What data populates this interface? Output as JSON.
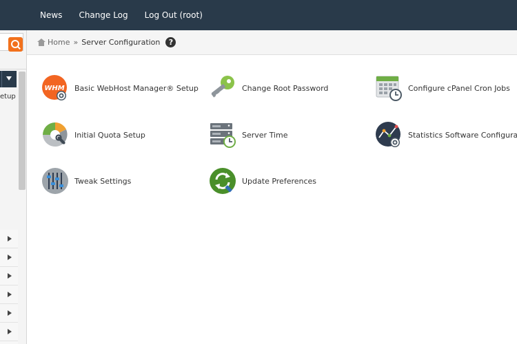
{
  "topnav": {
    "items": [
      {
        "label": "News"
      },
      {
        "label": "Change Log"
      },
      {
        "label": "Log Out (root)"
      }
    ]
  },
  "sidebar": {
    "partial_label": "etup",
    "collapsed_rows": 7
  },
  "breadcrumb": {
    "home": "Home",
    "separator": "»",
    "current": "Server Configuration",
    "help": "?"
  },
  "tools": [
    {
      "label": "Basic WebHost Manager® Setup",
      "icon": "whm-logo-gear-icon"
    },
    {
      "label": "Change Root Password",
      "icon": "key-icon"
    },
    {
      "label": "Configure cPanel Cron Jobs",
      "icon": "calendar-clock-icon"
    },
    {
      "label": "Initial Quota Setup",
      "icon": "pie-chart-wrench-icon"
    },
    {
      "label": "Server Time",
      "icon": "server-clock-icon"
    },
    {
      "label": "Statistics Software Configuration",
      "icon": "graph-gear-icon"
    },
    {
      "label": "Tweak Settings",
      "icon": "sliders-icon"
    },
    {
      "label": "Update Preferences",
      "icon": "refresh-update-icon"
    }
  ],
  "colors": {
    "topbar": "#293a4a",
    "accent": "#f2711c",
    "update_green": "#4a8f2a"
  }
}
